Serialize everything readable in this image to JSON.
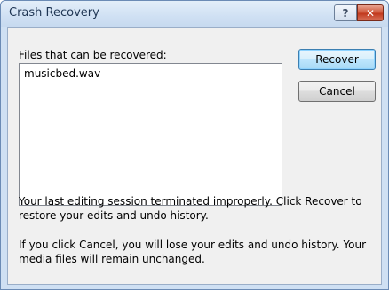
{
  "window": {
    "title": "Crash Recovery",
    "help_label": "?",
    "close_label": "✕"
  },
  "files": {
    "label": "Files that can be recovered:",
    "items": [
      "musicbed.wav"
    ]
  },
  "buttons": {
    "recover": "Recover",
    "cancel": "Cancel"
  },
  "messages": {
    "line1": "Your last editing session terminated improperly. Click Recover to restore your edits and undo history.",
    "line2": "If you click Cancel, you will lose your edits and undo history. Your media files will remain unchanged."
  },
  "colors": {
    "title_bar": "#cfe0f3",
    "client_bg": "#f0f0f0",
    "close_button": "#c23a1e",
    "default_button_border": "#3c7fb1"
  }
}
